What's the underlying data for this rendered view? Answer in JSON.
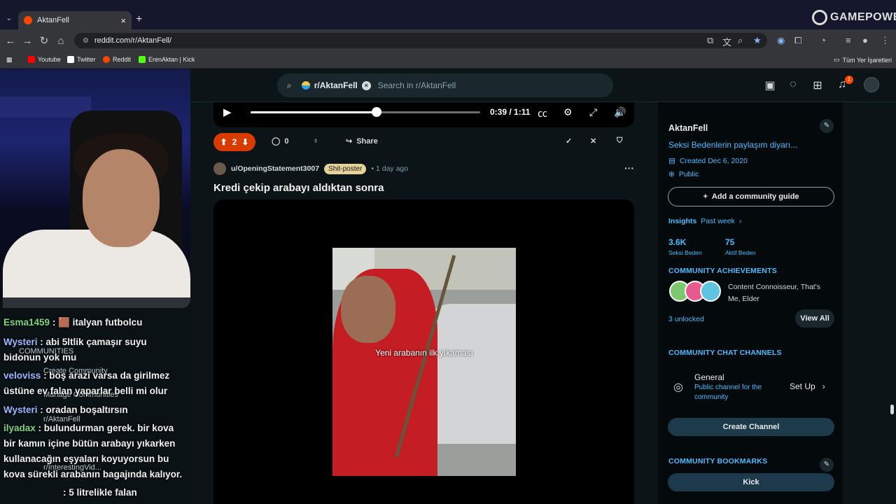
{
  "browser": {
    "tab_title": "AktanFell",
    "url": "reddit.com/r/AktanFell/",
    "overlay_brand": "GAMEPOWER",
    "bookmarks": [
      {
        "label": "Youtube"
      },
      {
        "label": "Twitter"
      },
      {
        "label": "Reddit"
      },
      {
        "label": "ErenAktan | Kick"
      }
    ],
    "bookmarks_all": "Tüm Yer İşaretleri"
  },
  "header": {
    "search_chip": "r/AktanFell",
    "search_placeholder": "Search in r/AktanFell",
    "notifications_count": "1"
  },
  "video": {
    "time": "0:39 / 1:11",
    "progress": 0.55
  },
  "actions": {
    "votes": "2",
    "comments": "0",
    "share": "Share"
  },
  "post": {
    "author": "u/OpeningStatement3007",
    "flair": "Shit-poster",
    "age": "1 day ago",
    "title": "Kredi çekip arabayı aldıktan sonra",
    "caption": "Yeni arabanın ilk yıkaması"
  },
  "sidebar": {
    "name": "AktanFell",
    "description": "Seksi Bedenlerin paylaşım diyarı...",
    "created": "Created Dec 6, 2020",
    "visibility": "Public",
    "add_guide": "Add a community guide",
    "insights": "Insights",
    "insights_period": "Past week",
    "members_count": "3.6K",
    "members_label": "Seksi Beden",
    "online_count": "75",
    "online_label": "Aktif Beden",
    "achievements_heading": "COMMUNITY ACHIEVEMENTS",
    "achievements_text": "Content Connoisseur, That's Me, Elder",
    "unlocked": "3 unlocked",
    "view_all": "View All",
    "chat_heading": "COMMUNITY CHAT CHANNELS",
    "channel_name": "General",
    "channel_desc": "Public channel for the community",
    "setup": "Set Up",
    "create_channel": "Create Channel",
    "bookmarks_heading": "COMMUNITY BOOKMARKS",
    "bookmark_kick": "Kick"
  },
  "chat": [
    {
      "user": "Esma1459",
      "text": ": 🟫 italyan futbolcu"
    },
    {
      "user": "Wysteri",
      "text": ": abi 5ltlik çamaşır suyu"
    },
    {
      "user": "",
      "text": "bidonun yok mu"
    },
    {
      "user": "veloviss",
      "text": ": boş arazi varsa da girilmez"
    },
    {
      "user": "",
      "text": "üstüne ev falan yaparlar belli mi olur"
    },
    {
      "user": "Wysteri",
      "text": ": oradan boşaltırsın"
    },
    {
      "user": "ilyadax",
      "text": ": bulundurman gerek. bir kova"
    },
    {
      "user": "",
      "text": "bir kamın içine bütün arabayı yıkarken"
    },
    {
      "user": "",
      "text": "kullanacağın eşyaları koyuyorsun bu"
    },
    {
      "user": "",
      "text": "kova sürekli arabanın bagajında kalıyor."
    },
    {
      "user": "",
      "text": ": 5 litrelikle falan"
    }
  ],
  "left_nav_ghost": {
    "communities": "COMMUNITIES",
    "create": "Create Community",
    "manage": "Manage Communities",
    "items": [
      "r/AktanFell",
      "r/InterestingVid..."
    ]
  }
}
